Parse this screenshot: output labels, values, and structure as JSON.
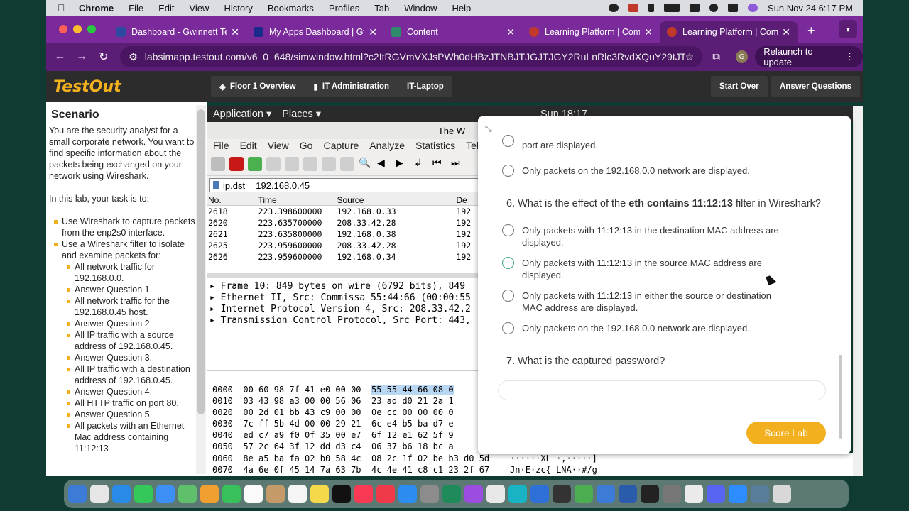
{
  "menubar": {
    "app": "Chrome",
    "items": [
      "File",
      "Edit",
      "View",
      "History",
      "Bookmarks",
      "Profiles",
      "Tab",
      "Window",
      "Help"
    ],
    "datetime": "Sun Nov 24  6:17 PM"
  },
  "tabs": [
    {
      "label": "Dashboard - Gwinnett Te",
      "color": "#2b4aa0"
    },
    {
      "label": "My Apps Dashboard | Gw",
      "color": "#1a2b8a"
    },
    {
      "label": "Content",
      "color": "#2e8a6b"
    },
    {
      "label": "Learning Platform | Comp",
      "color": "#c0392b"
    },
    {
      "label": "Learning Platform | Comp",
      "color": "#c0392b"
    }
  ],
  "addressbar": {
    "url": "labsimapp.testout.com/v6_0_648/simwindow.html?c2ItRGVmVXJsPWh0dHBzJTNBJTJGJTJGY2RuLnRlc3RvdXQuY29tJTJ...",
    "avatar": "G",
    "relaunch": "Relaunch to update"
  },
  "testout": {
    "logo": "TestOut",
    "breadcrumbs": [
      "Floor 1 Overview",
      "IT Administration",
      "IT-Laptop"
    ],
    "start_over": "Start Over",
    "answer_questions": "Answer Questions"
  },
  "scenario": {
    "title": "Scenario",
    "intro": "You are the security analyst for a small corporate network. You want to find specific information about the packets being exchanged on your network using Wireshark.",
    "task_intro": "In this lab, your task is to:",
    "tasks": [
      "Use Wireshark to capture packets from the enp2s0 interface.",
      "Use a Wireshark filter to isolate and examine packets for:"
    ],
    "subtasks": [
      "All network traffic for 192.168.0.0.",
      "Answer Question 1.",
      "All network traffic for the 192.168.0.45 host.",
      "Answer Question 2.",
      "All IP traffic with a source address of 192.168.0.45.",
      "Answer Question 3.",
      "All IP traffic with a destination address of 192.168.0.45.",
      "Answer Question 4.",
      "All HTTP traffic on port 80.",
      "Answer Question 5.",
      "All packets with an Ethernet Mac address containing 11:12:13"
    ]
  },
  "gnome": {
    "applications": "Application ▾",
    "places": "Places ▾",
    "clock": "Sun 18:17"
  },
  "wireshark": {
    "title": "The W",
    "menu": [
      "File",
      "Edit",
      "View",
      "Go",
      "Capture",
      "Analyze",
      "Statistics",
      "Tel"
    ],
    "filter": "ip.dst==192.168.0.45",
    "columns": [
      "No.",
      "Time",
      "Source",
      "De"
    ],
    "rows": [
      [
        "2618",
        "223.398600000",
        "192.168.0.33",
        "192"
      ],
      [
        "2620",
        "223.635700000",
        "208.33.42.28",
        "192"
      ],
      [
        "2621",
        "223.635800000",
        "192.168.0.38",
        "192"
      ],
      [
        "2625",
        "223.959600000",
        "208.33.42.28",
        "192"
      ],
      [
        "2626",
        "223.959600000",
        "192.168.0.34",
        "192"
      ]
    ],
    "details": [
      "Frame 10: 849 bytes on wire (6792 bits), 849",
      "Ethernet II, Src: Commissa_55:44:66 (00:00:55",
      "Internet Protocol Version 4, Src: 208.33.42.2",
      "Transmission Control Protocol, Src Port: 443,"
    ],
    "hex": [
      [
        "0000",
        "00 60 98 7f 41 e0 00 00",
        "55 55 44 66 08 0"
      ],
      [
        "0010",
        "03 43 98 a3 00 00 56 06",
        "23 ad d0 21 2a 1"
      ],
      [
        "0020",
        "00 2d 01 bb 43 c9 00 00",
        "0e cc 00 00 00 0"
      ],
      [
        "0030",
        "7c ff 5b 4d 00 00 29 21",
        "6c e4 b5 ba d7 e"
      ],
      [
        "0040",
        "ed c7 a9 f0 0f 35 00 e7",
        "6f 12 e1 62 5f 9"
      ],
      [
        "0050",
        "57 2c 64 3f 12 dd d3 c4",
        "06 37 b6 18 bc a"
      ],
      [
        "0060",
        "8e a5 ba fa 02 b0 58 4c",
        "08 2c 1f 02 be b3 d0 5d",
        "······XL ·,·····]"
      ],
      [
        "0070",
        "4a 6e 0f 45 14 7a 63 7b",
        "4c 4e 41 c8 c1 23 2f 67",
        "Jn·E·zc{ LNA··#/g"
      ]
    ]
  },
  "questions": {
    "q5_tail": "port are displayed.",
    "q5_last": "Only packets on the 192.168.0.0 network are displayed.",
    "q6_prefix": "6. What is the effect of the ",
    "q6_bold": "eth contains 11:12:13",
    "q6_suffix": " filter in Wireshark?",
    "q6_options": [
      "Only packets with 11:12:13 in the destination MAC address are displayed.",
      "Only packets with 11:12:13 in the source MAC address are displayed.",
      "Only packets with 11:12:13 in either the source or destination MAC address are displayed.",
      "Only packets on the 192.168.0.0 network are displayed."
    ],
    "q7": "7. What is the captured password?",
    "password_value": "",
    "score_lab": "Score Lab"
  }
}
